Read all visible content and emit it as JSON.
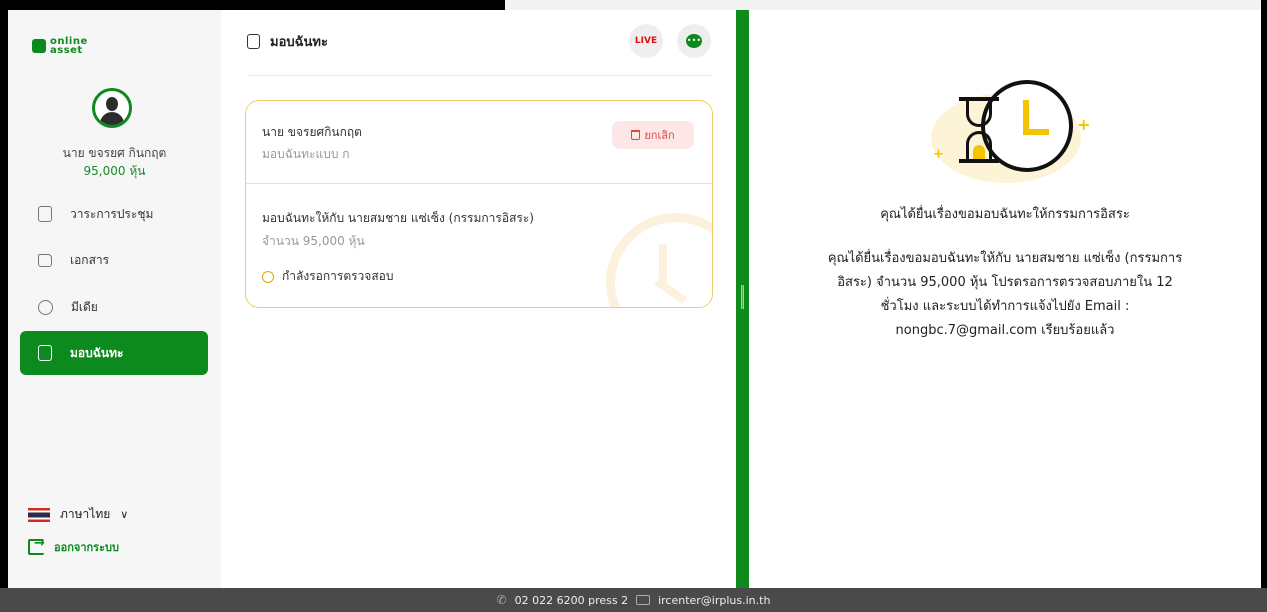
{
  "sidebar": {
    "logo_line1": "online",
    "logo_line2": "asset",
    "user_name": "นาย ขจรยศ กินกฤต",
    "user_shares": "95,000 หุ้น",
    "nav": [
      {
        "label": "วาระการประชุม",
        "icon": "agenda-icon"
      },
      {
        "label": "เอกสาร",
        "icon": "folder-icon"
      },
      {
        "label": "มีเดีย",
        "icon": "play-icon"
      },
      {
        "label": "มอบฉันทะ",
        "icon": "proxy-icon",
        "active": true
      }
    ],
    "language": "ภาษาไทย",
    "logout": "ออกจากระบบ"
  },
  "header": {
    "title": "มอบฉันทะ",
    "live_label": "LIVE"
  },
  "card": {
    "proxy_name": "นาย ขจรยศกินกฤต",
    "proxy_type": "มอบฉันทะแบบ ก",
    "cancel_label": "ยกเลิก",
    "detail_line": "มอบฉันทะให้กับ นายสมชาย แซ่เซ็ง (กรรมการอิสระ)",
    "detail_amount": "จำนวน 95,000 หุ้น",
    "status": "กำลังรอการตรวจสอบ",
    "accent_color": "#f1cc6a"
  },
  "message": {
    "title": "คุณได้ยื่นเรื่องขอมอบฉันทะให้กรรมการอิสระ",
    "body_line1": "คุณได้ยื่นเรื่องขอมอบฉันทะให้กับ นายสมชาย แซ่เซ็ง (กรรมการ",
    "body_line2": "อิสระ) จำนวน 95,000 หุ้น โปรดรอการตรวจสอบภายใน 12",
    "body_line3": "ชั่วโมง และระบบได้ทำการแจ้งไปยัง Email :",
    "body_line4": "nongbc.7@gmail.com เรียบร้อยแล้ว"
  },
  "footer": {
    "phone": "02 022 6200 press 2",
    "email": "ircenter@irplus.in.th"
  },
  "colors": {
    "brand": "#0d8a1e",
    "divider": "#118a1c",
    "cancel_bg": "#fde6e6",
    "cancel_text": "#e04646"
  }
}
